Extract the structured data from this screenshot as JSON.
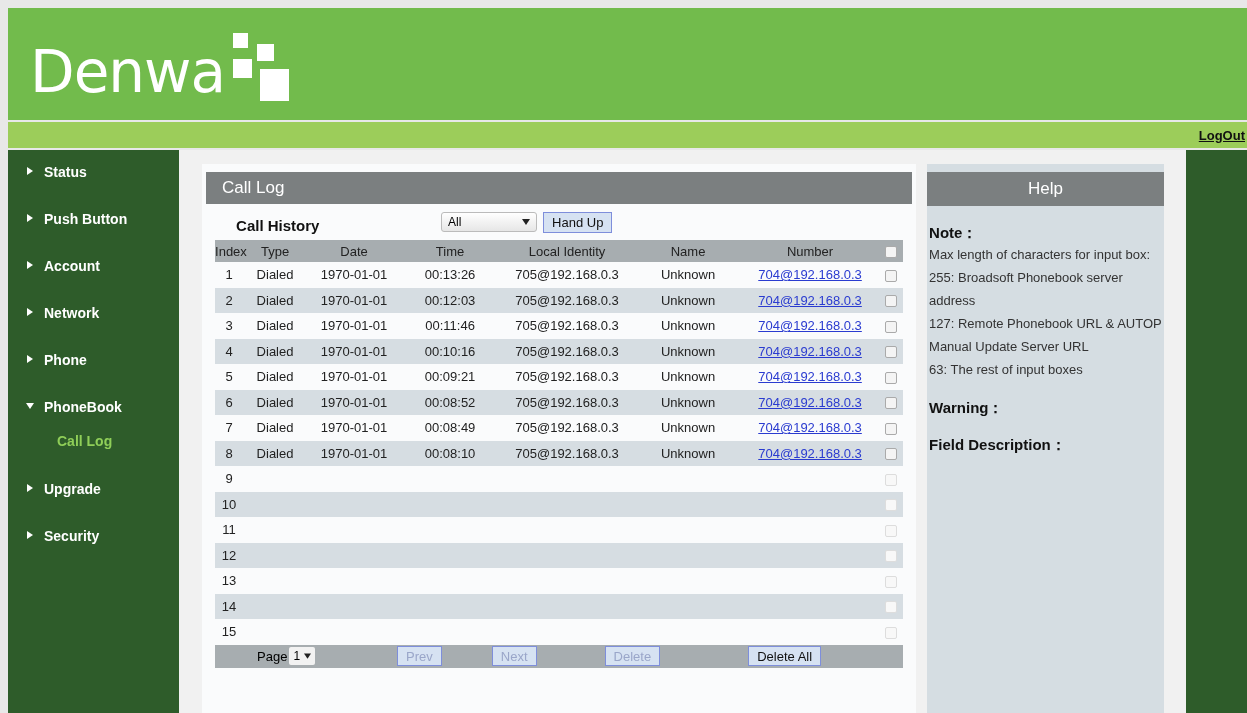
{
  "header": {
    "logo": "Denwa",
    "logout": "LogOut"
  },
  "sidebar": {
    "items": [
      {
        "label": "Status",
        "expanded": false
      },
      {
        "label": "Push Button",
        "expanded": false
      },
      {
        "label": "Account",
        "expanded": false
      },
      {
        "label": "Network",
        "expanded": false
      },
      {
        "label": "Phone",
        "expanded": false
      },
      {
        "label": "PhoneBook",
        "expanded": true,
        "children": [
          {
            "label": "Call Log",
            "selected": true
          }
        ]
      },
      {
        "label": "Upgrade",
        "expanded": false
      },
      {
        "label": "Security",
        "expanded": false
      }
    ]
  },
  "panel": {
    "title": "Call Log",
    "subtitle": "Call History",
    "filter": "All",
    "hand_up": "Hand Up"
  },
  "table": {
    "columns": [
      "Index",
      "Type",
      "Date",
      "Time",
      "Local Identity",
      "Name",
      "Number"
    ],
    "select_all": {
      "checked": false
    },
    "rows": [
      {
        "index": "1",
        "type": "Dialed",
        "date": "1970-01-01",
        "time": "00:13:26",
        "local": "705@192.168.0.3",
        "name": "Unknown",
        "number": "704@192.168.0.3",
        "checked": false,
        "disabled": false
      },
      {
        "index": "2",
        "type": "Dialed",
        "date": "1970-01-01",
        "time": "00:12:03",
        "local": "705@192.168.0.3",
        "name": "Unknown",
        "number": "704@192.168.0.3",
        "checked": false,
        "disabled": false
      },
      {
        "index": "3",
        "type": "Dialed",
        "date": "1970-01-01",
        "time": "00:11:46",
        "local": "705@192.168.0.3",
        "name": "Unknown",
        "number": "704@192.168.0.3",
        "checked": false,
        "disabled": false
      },
      {
        "index": "4",
        "type": "Dialed",
        "date": "1970-01-01",
        "time": "00:10:16",
        "local": "705@192.168.0.3",
        "name": "Unknown",
        "number": "704@192.168.0.3",
        "checked": false,
        "disabled": false
      },
      {
        "index": "5",
        "type": "Dialed",
        "date": "1970-01-01",
        "time": "00:09:21",
        "local": "705@192.168.0.3",
        "name": "Unknown",
        "number": "704@192.168.0.3",
        "checked": false,
        "disabled": false
      },
      {
        "index": "6",
        "type": "Dialed",
        "date": "1970-01-01",
        "time": "00:08:52",
        "local": "705@192.168.0.3",
        "name": "Unknown",
        "number": "704@192.168.0.3",
        "checked": false,
        "disabled": false
      },
      {
        "index": "7",
        "type": "Dialed",
        "date": "1970-01-01",
        "time": "00:08:49",
        "local": "705@192.168.0.3",
        "name": "Unknown",
        "number": "704@192.168.0.3",
        "checked": false,
        "disabled": false
      },
      {
        "index": "8",
        "type": "Dialed",
        "date": "1970-01-01",
        "time": "00:08:10",
        "local": "705@192.168.0.3",
        "name": "Unknown",
        "number": "704@192.168.0.3",
        "checked": false,
        "disabled": false
      },
      {
        "index": "9",
        "checked": false,
        "disabled": true
      },
      {
        "index": "10",
        "checked": false,
        "disabled": true
      },
      {
        "index": "11",
        "checked": false,
        "disabled": true
      },
      {
        "index": "12",
        "checked": false,
        "disabled": true
      },
      {
        "index": "13",
        "checked": false,
        "disabled": true
      },
      {
        "index": "14",
        "checked": false,
        "disabled": true
      },
      {
        "index": "15",
        "checked": false,
        "disabled": true
      }
    ]
  },
  "pager": {
    "label": "Page",
    "page": "1",
    "buttons": [
      {
        "label": "Prev",
        "disabled": true
      },
      {
        "label": "Next",
        "disabled": true
      },
      {
        "label": "Delete",
        "disabled": true
      },
      {
        "label": "Delete All",
        "disabled": false
      }
    ]
  },
  "help": {
    "title": "Help",
    "sections": [
      {
        "heading": "Note：",
        "lines": [
          "Max length of characters for input box:",
          "255: Broadsoft Phonebook server address",
          "127: Remote Phonebook URL & AUTOP Manual Update Server URL",
          "63: The rest of input boxes"
        ]
      },
      {
        "heading": "Warning："
      },
      {
        "heading": "Field Description："
      }
    ]
  }
}
